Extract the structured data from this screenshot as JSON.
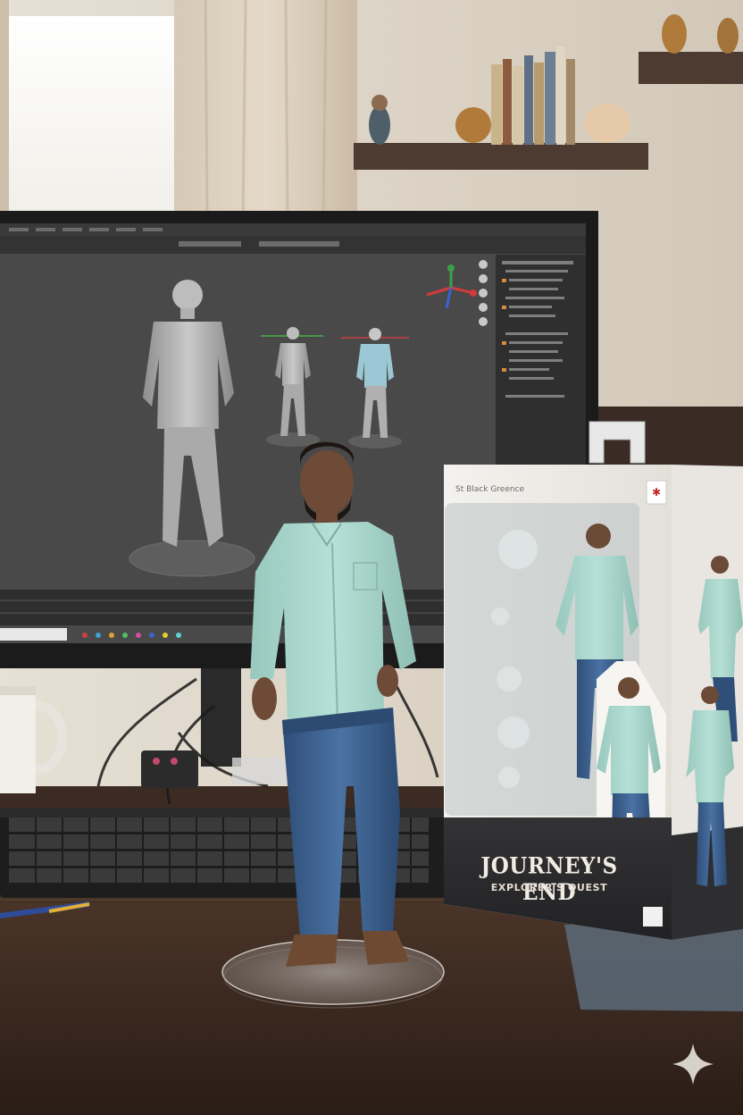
{
  "scene": {
    "description_free": true
  },
  "box": {
    "title": "JOURNEY'S END",
    "subtitle": "EXPLORER'S QUEST",
    "top_line": "St Black Greence",
    "brand_logo": "JOURNEY'S END"
  },
  "colors": {
    "wall": "#d9d1c5",
    "desk": "#3b2a21",
    "shirt": "#a9d6cc",
    "jeans": "#3a5f8f",
    "monitor_bezel": "#1c1c1c",
    "viewport_bg": "#4a4a4a",
    "box_dark": "#2b2b2d"
  },
  "icons": {
    "sparkle": "sparkle-icon"
  }
}
